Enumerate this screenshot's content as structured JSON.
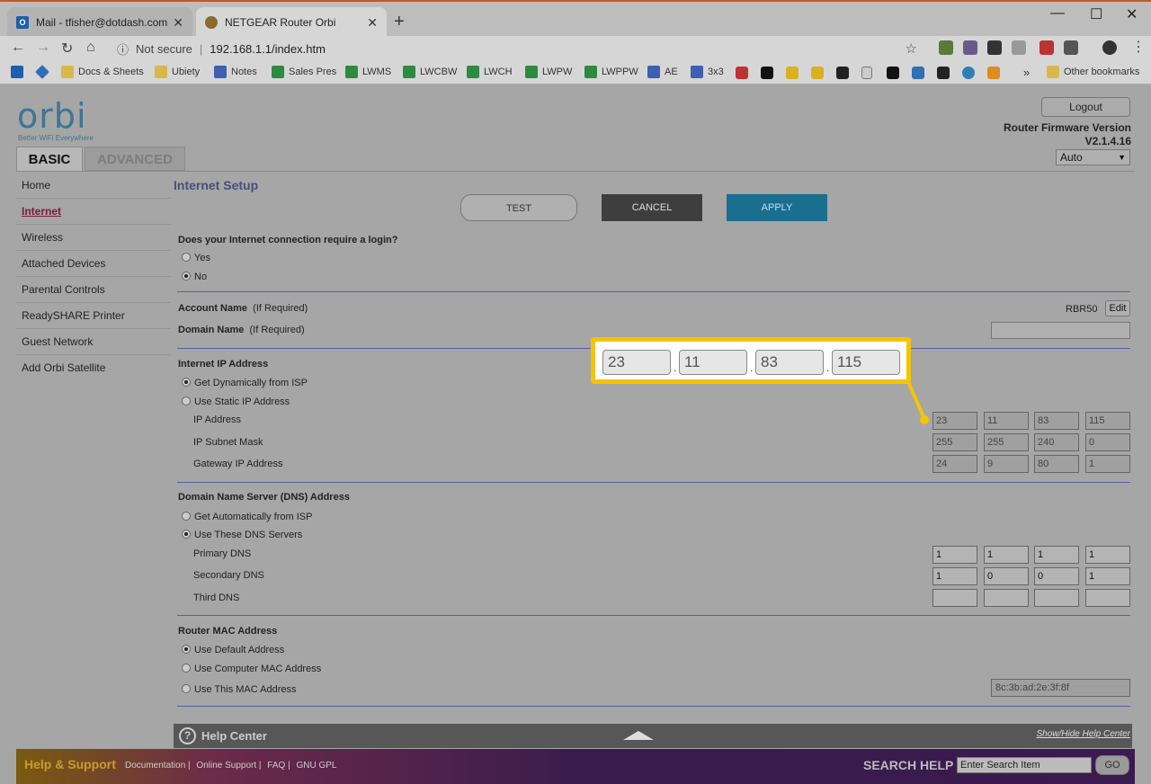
{
  "browser": {
    "tabs": [
      {
        "title": "Mail - tfisher@dotdash.com",
        "icon": "outlook-icon",
        "active": false
      },
      {
        "title": "NETGEAR Router Orbi",
        "icon": "netgear-icon",
        "active": true
      }
    ],
    "new_tab": "+",
    "window": {
      "minimize": "—",
      "maximize": "☐",
      "close": "✕"
    },
    "address": {
      "security": "Not secure",
      "url": "192.168.1.1/index.htm"
    },
    "bookmarks": [
      {
        "label": "",
        "color": "#2f6fb5"
      },
      {
        "label": "Docs & Sheets",
        "color": "#d9b84a"
      },
      {
        "label": "Ubiety",
        "color": "#d9b84a"
      },
      {
        "label": "Notes",
        "color": "#3f5fb0"
      },
      {
        "label": "Sales Pres",
        "color": "#2f8a3f"
      },
      {
        "label": "LWMS",
        "color": "#2f8a3f"
      },
      {
        "label": "LWCBW",
        "color": "#2f8a3f"
      },
      {
        "label": "LWCH",
        "color": "#2f8a3f"
      },
      {
        "label": "LWPW",
        "color": "#2f8a3f"
      },
      {
        "label": "LWPPW",
        "color": "#2f8a3f"
      },
      {
        "label": "AE",
        "color": "#3f5fb0"
      },
      {
        "label": "3x3",
        "color": "#3f5fb0"
      }
    ],
    "bookmarks_more": "»",
    "other_bookmarks": "Other bookmarks"
  },
  "router": {
    "logo": "orbi",
    "logo_tagline": "Better WiFi Everywhere",
    "logout": "Logout",
    "firmware_label": "Router Firmware Version",
    "firmware_version": "V2.1.4.16",
    "language": "Auto",
    "tabs": {
      "basic": "BASIC",
      "advanced": "ADVANCED"
    },
    "sidebar": [
      {
        "label": "Home",
        "active": false
      },
      {
        "label": "Internet",
        "active": true
      },
      {
        "label": "Wireless",
        "active": false
      },
      {
        "label": "Attached Devices",
        "active": false
      },
      {
        "label": "Parental Controls",
        "active": false
      },
      {
        "label": "ReadySHARE Printer",
        "active": false
      },
      {
        "label": "Guest Network",
        "active": false
      },
      {
        "label": "Add Orbi Satellite",
        "active": false
      }
    ],
    "page_title": "Internet Setup",
    "buttons": {
      "test": "TEST",
      "cancel": "CANCEL",
      "apply": "APPLY"
    },
    "login_question": "Does your Internet connection require a login?",
    "login_yes": "Yes",
    "login_no": "No",
    "account_name_label": "Account Name",
    "account_name_hint": "(If Required)",
    "account_name_value": "RBR50",
    "edit": "Edit",
    "domain_name_label": "Domain Name",
    "domain_name_hint": "(If Required)",
    "ip_section": "Internet IP Address",
    "ip_dynamic": "Get Dynamically from ISP",
    "ip_static": "Use Static IP Address",
    "ip_address_label": "IP Address",
    "ip_address": [
      "23",
      "11",
      "83",
      "115"
    ],
    "subnet_label": "IP Subnet Mask",
    "subnet": [
      "255",
      "255",
      "240",
      "0"
    ],
    "gateway_label": "Gateway IP Address",
    "gateway": [
      "24",
      "9",
      "80",
      "1"
    ],
    "dns_section": "Domain Name Server (DNS) Address",
    "dns_auto": "Get Automatically from ISP",
    "dns_manual": "Use These DNS Servers",
    "primary_dns_label": "Primary DNS",
    "primary_dns": [
      "1",
      "1",
      "1",
      "1"
    ],
    "secondary_dns_label": "Secondary DNS",
    "secondary_dns": [
      "1",
      "0",
      "0",
      "1"
    ],
    "third_dns_label": "Third DNS",
    "third_dns": [
      "",
      "",
      "",
      ""
    ],
    "mac_section": "Router MAC Address",
    "mac_default": "Use Default Address",
    "mac_computer": "Use Computer MAC Address",
    "mac_this": "Use This MAC Address",
    "mac_value": "8c:3b:ad:2e:3f:8f",
    "help_center": "Help Center",
    "help_toggle": "Show/Hide Help Center",
    "footer": {
      "title": "Help & Support",
      "links": [
        "Documentation |",
        "Online Support |",
        "FAQ |",
        "GNU GPL"
      ],
      "search_label": "SEARCH HELP",
      "search_value": "Enter Search Item",
      "go": "GO"
    }
  },
  "callout": {
    "ip": [
      "23",
      "11",
      "83",
      "115"
    ],
    "color": "#f5c400"
  }
}
